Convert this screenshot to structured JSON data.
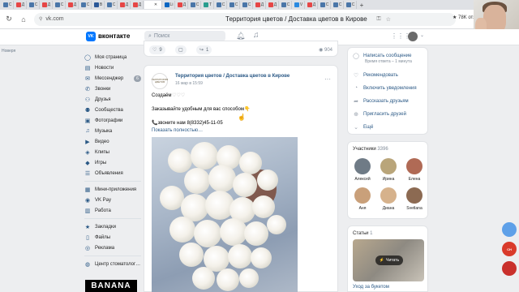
{
  "browser": {
    "page_title": "Территория цветов / Доставка цветов в Кирове",
    "url": "vk.com",
    "reviews": "78K отзывов",
    "tab_labels": [
      "C",
      "Д",
      "C",
      "Д",
      "C",
      "Д",
      "C",
      "B",
      "C",
      "Д",
      "Д",
      "✕",
      "Li",
      "Д",
      "C",
      "T",
      "C",
      "C",
      "C",
      "Д",
      "Д",
      "C",
      "V",
      "Д",
      "C",
      "C",
      "C",
      "+"
    ]
  },
  "vk": {
    "logo_text": "VK",
    "name": "вконтакте",
    "search_placeholder": "Поиск",
    "left_label": "Новеря"
  },
  "menu": {
    "items": [
      {
        "label": "Моя страница",
        "icon": "user-icon"
      },
      {
        "label": "Новости",
        "icon": "news-icon"
      },
      {
        "label": "Мессенджер",
        "icon": "message-icon",
        "badge": "6"
      },
      {
        "label": "Звонки",
        "icon": "phone-icon"
      },
      {
        "label": "Друзья",
        "icon": "friends-icon"
      },
      {
        "label": "Сообщества",
        "icon": "groups-icon"
      },
      {
        "label": "Фотографии",
        "icon": "photo-icon"
      },
      {
        "label": "Музыка",
        "icon": "music-icon"
      },
      {
        "label": "Видео",
        "icon": "video-icon"
      },
      {
        "label": "Клипы",
        "icon": "clips-icon"
      },
      {
        "label": "Игры",
        "icon": "games-icon"
      },
      {
        "label": "Объявления",
        "icon": "ads-icon"
      }
    ],
    "items2": [
      {
        "label": "Мини-приложения",
        "icon": "apps-icon"
      },
      {
        "label": "VK Pay",
        "icon": "pay-icon"
      },
      {
        "label": "Работа",
        "icon": "work-icon"
      }
    ],
    "items3": [
      {
        "label": "Закладки",
        "icon": "bookmark-icon"
      },
      {
        "label": "Файлы",
        "icon": "file-icon"
      },
      {
        "label": "Реклама",
        "icon": "ad-icon"
      }
    ],
    "items4": [
      {
        "label": "Центр стоматолог…",
        "icon": "dental-icon"
      }
    ],
    "banana": "BANANA"
  },
  "top_card": {
    "likes": "9",
    "shares": "1",
    "views": "904"
  },
  "post": {
    "avatar_text": "ТЕРРИТОРИЯ ЦВЕТОВ",
    "author": "Территория цветов / Доставка цветов в Кирове",
    "date": "16 мар в 15:59",
    "tag": "Создаём",
    "hearts": "♡♡♡",
    "line1": "Заказывайте удобным для вас способом👇",
    "line2": "📞звоните нам 8(8332)45-11-05",
    "show_more": "Показать полностью…"
  },
  "right": {
    "actions": [
      {
        "label": "Написать сообщение",
        "icon": "message-icon"
      },
      {
        "label": "Рекомендовать",
        "icon": "like-icon"
      },
      {
        "label": "Включить уведомления",
        "icon": "bell-icon"
      },
      {
        "label": "Рассказать друзьям",
        "icon": "share-icon"
      },
      {
        "label": "Пригласить друзей",
        "icon": "invite-icon"
      },
      {
        "label": "Ещё",
        "icon": "chevron-down-icon"
      }
    ],
    "reply_time": "Время ответа – 1 минута",
    "members_title": "Участники",
    "members_count": "3396",
    "members": [
      {
        "name": "Алексей",
        "color": "#6f7b86"
      },
      {
        "name": "Ирина",
        "color": "#b9a57a"
      },
      {
        "name": "Елена",
        "color": "#b06a55"
      },
      {
        "name": "Аня",
        "color": "#c9a07a"
      },
      {
        "name": "Диана",
        "color": "#d6b28c"
      },
      {
        "name": "Svetlana",
        "color": "#8c6a52"
      }
    ],
    "stories_title": "Статьи",
    "stories_count": "1",
    "story_button": "Читать",
    "story_caption": "Уход за букетом"
  },
  "side_badges": [
    {
      "text": "",
      "color": "#5ea0e8"
    },
    {
      "text": "CH",
      "color": "#d93a2b"
    },
    {
      "text": "",
      "color": "#c9302c"
    }
  ]
}
